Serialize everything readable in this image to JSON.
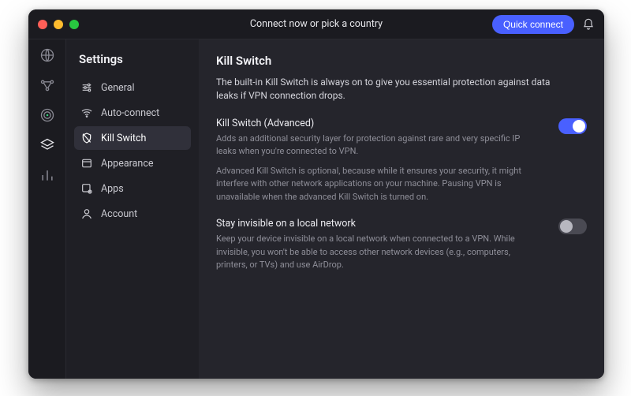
{
  "titlebar": {
    "title": "Connect now or pick a country",
    "quick_connect": "Quick connect"
  },
  "rail": {
    "items": [
      {
        "name": "globe",
        "active": false
      },
      {
        "name": "nodes",
        "active": false
      },
      {
        "name": "radar",
        "active": false
      },
      {
        "name": "layers",
        "active": true
      },
      {
        "name": "stats",
        "active": false
      }
    ]
  },
  "sidebar": {
    "title": "Settings",
    "items": [
      {
        "key": "general",
        "label": "General",
        "active": false
      },
      {
        "key": "auto-connect",
        "label": "Auto-connect",
        "active": false
      },
      {
        "key": "kill-switch",
        "label": "Kill Switch",
        "active": true
      },
      {
        "key": "appearance",
        "label": "Appearance",
        "active": false
      },
      {
        "key": "apps",
        "label": "Apps",
        "active": false
      },
      {
        "key": "account",
        "label": "Account",
        "active": false
      }
    ]
  },
  "main": {
    "heading": "Kill Switch",
    "intro": "The built-in Kill Switch is always on to give you essential protection against data leaks if VPN connection drops.",
    "settings": [
      {
        "key": "advanced",
        "title": "Kill Switch (Advanced)",
        "desc1": "Adds an additional security layer for protection against rare and very specific IP leaks when you're connected to VPN.",
        "desc2": "Advanced Kill Switch is optional, because while it ensures your security, it might interfere with other network applications on your machine. Pausing VPN is unavailable when the advanced Kill Switch is turned on.",
        "on": true
      },
      {
        "key": "invisible",
        "title": "Stay invisible on a local network",
        "desc1": "Keep your device invisible on a local network when connected to a VPN. While invisible, you won't be able to access other network devices (e.g., computers, printers, or TVs) and use AirDrop.",
        "on": false
      }
    ]
  }
}
